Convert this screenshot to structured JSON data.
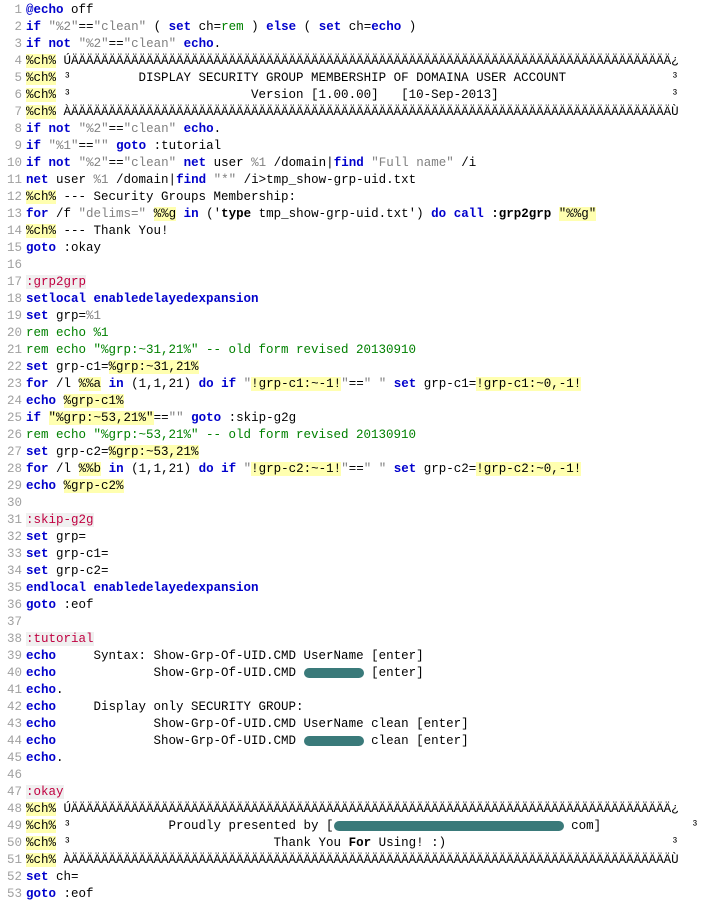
{
  "lines": [
    {
      "n": 1,
      "segs": [
        {
          "t": "@echo",
          "c": "kw"
        },
        {
          "t": " off"
        }
      ]
    },
    {
      "n": 2,
      "segs": [
        {
          "t": "if",
          "c": "kw"
        },
        {
          "t": " "
        },
        {
          "t": "\"%2\"",
          "c": "str"
        },
        {
          "t": "=="
        },
        {
          "t": "\"clean\"",
          "c": "str"
        },
        {
          "t": " ( "
        },
        {
          "t": "set",
          "c": "kw"
        },
        {
          "t": " ch="
        },
        {
          "t": "rem",
          "c": "cmt"
        },
        {
          "t": " ) "
        },
        {
          "t": "else",
          "c": "kw"
        },
        {
          "t": " ( "
        },
        {
          "t": "set",
          "c": "kw"
        },
        {
          "t": " ch="
        },
        {
          "t": "echo",
          "c": "kw"
        },
        {
          "t": " )"
        }
      ]
    },
    {
      "n": 3,
      "segs": [
        {
          "t": "if",
          "c": "kw"
        },
        {
          "t": " "
        },
        {
          "t": "not",
          "c": "kw"
        },
        {
          "t": " "
        },
        {
          "t": "\"%2\"",
          "c": "str"
        },
        {
          "t": "=="
        },
        {
          "t": "\"clean\"",
          "c": "str"
        },
        {
          "t": " "
        },
        {
          "t": "echo",
          "c": "kw"
        },
        {
          "t": "."
        }
      ]
    },
    {
      "n": 4,
      "segs": [
        {
          "t": "%ch%",
          "c": "hl"
        },
        {
          "t": " ÚÄÄÄÄÄÄÄÄÄÄÄÄÄÄÄÄÄÄÄÄÄÄÄÄÄÄÄÄÄÄÄÄÄÄÄÄÄÄÄÄÄÄÄÄÄÄÄÄÄÄÄÄÄÄÄÄÄÄÄÄÄÄÄÄÄÄÄÄÄÄÄÄÄÄÄÄÄÄÄÄ¿"
        }
      ]
    },
    {
      "n": 5,
      "segs": [
        {
          "t": "%ch%",
          "c": "hl"
        },
        {
          "t": " ³         DISPLAY SECURITY GROUP MEMBERSHIP OF DOMAINA USER ACCOUNT              ³"
        }
      ]
    },
    {
      "n": 6,
      "segs": [
        {
          "t": "%ch%",
          "c": "hl"
        },
        {
          "t": " ³                        Version [1.00.00]   [10-Sep-2013]                       ³"
        }
      ]
    },
    {
      "n": 7,
      "segs": [
        {
          "t": "%ch%",
          "c": "hl"
        },
        {
          "t": " ÀÄÄÄÄÄÄÄÄÄÄÄÄÄÄÄÄÄÄÄÄÄÄÄÄÄÄÄÄÄÄÄÄÄÄÄÄÄÄÄÄÄÄÄÄÄÄÄÄÄÄÄÄÄÄÄÄÄÄÄÄÄÄÄÄÄÄÄÄÄÄÄÄÄÄÄÄÄÄÄÄÙ"
        }
      ]
    },
    {
      "n": 8,
      "segs": [
        {
          "t": "if",
          "c": "kw"
        },
        {
          "t": " "
        },
        {
          "t": "not",
          "c": "kw"
        },
        {
          "t": " "
        },
        {
          "t": "\"%2\"",
          "c": "str"
        },
        {
          "t": "=="
        },
        {
          "t": "\"clean\"",
          "c": "str"
        },
        {
          "t": " "
        },
        {
          "t": "echo",
          "c": "kw"
        },
        {
          "t": "."
        }
      ]
    },
    {
      "n": 9,
      "segs": [
        {
          "t": "if",
          "c": "kw"
        },
        {
          "t": " "
        },
        {
          "t": "\"%1\"",
          "c": "str"
        },
        {
          "t": "=="
        },
        {
          "t": "\"\"",
          "c": "str"
        },
        {
          "t": " "
        },
        {
          "t": "goto",
          "c": "kw"
        },
        {
          "t": " :tutorial",
          "c": "lblref"
        }
      ]
    },
    {
      "n": 10,
      "segs": [
        {
          "t": "if",
          "c": "kw"
        },
        {
          "t": " "
        },
        {
          "t": "not",
          "c": "kw"
        },
        {
          "t": " "
        },
        {
          "t": "\"%2\"",
          "c": "str"
        },
        {
          "t": "=="
        },
        {
          "t": "\"clean\"",
          "c": "str"
        },
        {
          "t": " "
        },
        {
          "t": "net",
          "c": "kw"
        },
        {
          "t": " user "
        },
        {
          "t": "%1",
          "c": "var"
        },
        {
          "t": " /domain|"
        },
        {
          "t": "find",
          "c": "kw"
        },
        {
          "t": " "
        },
        {
          "t": "\"Full name\"",
          "c": "str"
        },
        {
          "t": " /i"
        }
      ]
    },
    {
      "n": 11,
      "segs": [
        {
          "t": "net",
          "c": "kw"
        },
        {
          "t": " user "
        },
        {
          "t": "%1",
          "c": "var"
        },
        {
          "t": " /domain|"
        },
        {
          "t": "find",
          "c": "kw"
        },
        {
          "t": " "
        },
        {
          "t": "\"*\"",
          "c": "str"
        },
        {
          "t": " /i>tmp_show-grp-uid.txt"
        }
      ]
    },
    {
      "n": 12,
      "segs": [
        {
          "t": "%ch%",
          "c": "hl"
        },
        {
          "t": " --- Security Groups Membership:"
        }
      ]
    },
    {
      "n": 13,
      "segs": [
        {
          "t": "for",
          "c": "kw"
        },
        {
          "t": " /f "
        },
        {
          "t": "\"delims=\"",
          "c": "str"
        },
        {
          "t": " "
        },
        {
          "t": "%%g",
          "c": "hl"
        },
        {
          "t": " "
        },
        {
          "t": "in",
          "c": "kw"
        },
        {
          "t": " ('"
        },
        {
          "t": "type",
          "c": "bkw"
        },
        {
          "t": " tmp_show-grp-uid.txt') "
        },
        {
          "t": "do",
          "c": "kw"
        },
        {
          "t": " "
        },
        {
          "t": "call",
          "c": "kw"
        },
        {
          "t": " "
        },
        {
          "t": ":grp2grp",
          "c": "bkw"
        },
        {
          "t": " "
        },
        {
          "t": "\"%%g\"",
          "c": "hl"
        }
      ]
    },
    {
      "n": 14,
      "segs": [
        {
          "t": "%ch%",
          "c": "hl"
        },
        {
          "t": " --- Thank You!"
        }
      ]
    },
    {
      "n": 15,
      "segs": [
        {
          "t": "goto",
          "c": "kw"
        },
        {
          "t": " :okay",
          "c": "lblref"
        }
      ]
    },
    {
      "n": 16,
      "segs": [
        {
          "t": ""
        }
      ]
    },
    {
      "n": 17,
      "segs": [
        {
          "t": ":grp2grp",
          "c": "lbl"
        }
      ]
    },
    {
      "n": 18,
      "segs": [
        {
          "t": "setlocal",
          "c": "kw"
        },
        {
          "t": " "
        },
        {
          "t": "enabledelayedexpansion",
          "c": "kw"
        }
      ]
    },
    {
      "n": 19,
      "segs": [
        {
          "t": "set",
          "c": "kw"
        },
        {
          "t": " grp="
        },
        {
          "t": "%1",
          "c": "var"
        }
      ]
    },
    {
      "n": 20,
      "segs": [
        {
          "t": "rem echo %1",
          "c": "cmt"
        }
      ]
    },
    {
      "n": 21,
      "segs": [
        {
          "t": "rem echo \"%grp:~31,21%\" -- old form revised 20130910",
          "c": "cmt"
        }
      ]
    },
    {
      "n": 22,
      "segs": [
        {
          "t": "set",
          "c": "kw"
        },
        {
          "t": " grp-c1="
        },
        {
          "t": "%grp:~31,21%",
          "c": "hl"
        }
      ]
    },
    {
      "n": 23,
      "segs": [
        {
          "t": "for",
          "c": "kw"
        },
        {
          "t": " /l "
        },
        {
          "t": "%%a",
          "c": "hl"
        },
        {
          "t": " "
        },
        {
          "t": "in",
          "c": "kw"
        },
        {
          "t": " (1,1,21) "
        },
        {
          "t": "do",
          "c": "kw"
        },
        {
          "t": " "
        },
        {
          "t": "if",
          "c": "kw"
        },
        {
          "t": " "
        },
        {
          "t": "\"",
          "c": "str"
        },
        {
          "t": "!grp-c1:~-1!",
          "c": "hl"
        },
        {
          "t": "\"",
          "c": "str"
        },
        {
          "t": "=="
        },
        {
          "t": "\" \"",
          "c": "str"
        },
        {
          "t": " "
        },
        {
          "t": "set",
          "c": "kw"
        },
        {
          "t": " grp-c1="
        },
        {
          "t": "!grp-c1:~0,-1!",
          "c": "hl"
        }
      ]
    },
    {
      "n": 24,
      "segs": [
        {
          "t": "echo",
          "c": "kw"
        },
        {
          "t": " "
        },
        {
          "t": "%grp-c1%",
          "c": "hl"
        }
      ]
    },
    {
      "n": 25,
      "segs": [
        {
          "t": "if",
          "c": "kw"
        },
        {
          "t": " "
        },
        {
          "t": "\"%grp:~53,21%\"",
          "c": "hl"
        },
        {
          "t": "=="
        },
        {
          "t": "\"\"",
          "c": "str"
        },
        {
          "t": " "
        },
        {
          "t": "goto",
          "c": "kw"
        },
        {
          "t": " :skip-g2g",
          "c": "lblref"
        }
      ]
    },
    {
      "n": 26,
      "segs": [
        {
          "t": "rem echo \"%grp:~53,21%\" -- old form revised 20130910",
          "c": "cmt"
        }
      ]
    },
    {
      "n": 27,
      "segs": [
        {
          "t": "set",
          "c": "kw"
        },
        {
          "t": " grp-c2="
        },
        {
          "t": "%grp:~53,21%",
          "c": "hl"
        }
      ]
    },
    {
      "n": 28,
      "segs": [
        {
          "t": "for",
          "c": "kw"
        },
        {
          "t": " /l "
        },
        {
          "t": "%%b",
          "c": "hl"
        },
        {
          "t": " "
        },
        {
          "t": "in",
          "c": "kw"
        },
        {
          "t": " (1,1,21) "
        },
        {
          "t": "do",
          "c": "kw"
        },
        {
          "t": " "
        },
        {
          "t": "if",
          "c": "kw"
        },
        {
          "t": " "
        },
        {
          "t": "\"",
          "c": "str"
        },
        {
          "t": "!grp-c2:~-1!",
          "c": "hl"
        },
        {
          "t": "\"",
          "c": "str"
        },
        {
          "t": "=="
        },
        {
          "t": "\" \"",
          "c": "str"
        },
        {
          "t": " "
        },
        {
          "t": "set",
          "c": "kw"
        },
        {
          "t": " grp-c2="
        },
        {
          "t": "!grp-c2:~0,-1!",
          "c": "hl"
        }
      ]
    },
    {
      "n": 29,
      "segs": [
        {
          "t": "echo",
          "c": "kw"
        },
        {
          "t": " "
        },
        {
          "t": "%grp-c2%",
          "c": "hl"
        }
      ]
    },
    {
      "n": 30,
      "segs": [
        {
          "t": ""
        }
      ]
    },
    {
      "n": 31,
      "segs": [
        {
          "t": ":skip-g2g",
          "c": "lbl"
        }
      ]
    },
    {
      "n": 32,
      "segs": [
        {
          "t": "set",
          "c": "kw"
        },
        {
          "t": " grp="
        }
      ]
    },
    {
      "n": 33,
      "segs": [
        {
          "t": "set",
          "c": "kw"
        },
        {
          "t": " grp-c1="
        }
      ]
    },
    {
      "n": 34,
      "segs": [
        {
          "t": "set",
          "c": "kw"
        },
        {
          "t": " grp-c2="
        }
      ]
    },
    {
      "n": 35,
      "segs": [
        {
          "t": "endlocal",
          "c": "kw"
        },
        {
          "t": " "
        },
        {
          "t": "enabledelayedexpansion",
          "c": "kw"
        }
      ]
    },
    {
      "n": 36,
      "segs": [
        {
          "t": "goto",
          "c": "kw"
        },
        {
          "t": " :eof",
          "c": "lblref"
        }
      ]
    },
    {
      "n": 37,
      "segs": [
        {
          "t": ""
        }
      ]
    },
    {
      "n": 38,
      "segs": [
        {
          "t": ":tutorial",
          "c": "lbl"
        }
      ]
    },
    {
      "n": 39,
      "segs": [
        {
          "t": "echo",
          "c": "kw"
        },
        {
          "t": "     Syntax: Show-Grp-Of-UID.CMD UserName [enter]"
        }
      ]
    },
    {
      "n": 40,
      "segs": [
        {
          "t": "echo",
          "c": "kw"
        },
        {
          "t": "             Show-Grp-Of-UID.CMD "
        },
        {
          "r": 60
        },
        {
          "t": " [enter]"
        }
      ]
    },
    {
      "n": 41,
      "segs": [
        {
          "t": "echo",
          "c": "kw"
        },
        {
          "t": "."
        }
      ]
    },
    {
      "n": 42,
      "segs": [
        {
          "t": "echo",
          "c": "kw"
        },
        {
          "t": "     Display only SECURITY GROUP:"
        }
      ]
    },
    {
      "n": 43,
      "segs": [
        {
          "t": "echo",
          "c": "kw"
        },
        {
          "t": "             Show-Grp-Of-UID.CMD UserName clean [enter]"
        }
      ]
    },
    {
      "n": 44,
      "segs": [
        {
          "t": "echo",
          "c": "kw"
        },
        {
          "t": "             Show-Grp-Of-UID.CMD "
        },
        {
          "r": 60
        },
        {
          "t": " clean [enter]"
        }
      ]
    },
    {
      "n": 45,
      "segs": [
        {
          "t": "echo",
          "c": "kw"
        },
        {
          "t": "."
        }
      ]
    },
    {
      "n": 46,
      "segs": [
        {
          "t": ""
        }
      ]
    },
    {
      "n": 47,
      "segs": [
        {
          "t": ":okay",
          "c": "lbl"
        }
      ]
    },
    {
      "n": 48,
      "segs": [
        {
          "t": "%ch%",
          "c": "hl"
        },
        {
          "t": " ÚÄÄÄÄÄÄÄÄÄÄÄÄÄÄÄÄÄÄÄÄÄÄÄÄÄÄÄÄÄÄÄÄÄÄÄÄÄÄÄÄÄÄÄÄÄÄÄÄÄÄÄÄÄÄÄÄÄÄÄÄÄÄÄÄÄÄÄÄÄÄÄÄÄÄÄÄÄÄÄÄ¿"
        }
      ]
    },
    {
      "n": 49,
      "segs": [
        {
          "t": "%ch%",
          "c": "hl"
        },
        {
          "t": " ³             Proudly presented by ["
        },
        {
          "r": 230
        },
        {
          "t": " com]            ³"
        }
      ]
    },
    {
      "n": 50,
      "segs": [
        {
          "t": "%ch%",
          "c": "hl"
        },
        {
          "t": " ³                           Thank You "
        },
        {
          "t": "For",
          "c": "bkw"
        },
        {
          "t": " Using! :)                              ³"
        }
      ]
    },
    {
      "n": 51,
      "segs": [
        {
          "t": "%ch%",
          "c": "hl"
        },
        {
          "t": " ÀÄÄÄÄÄÄÄÄÄÄÄÄÄÄÄÄÄÄÄÄÄÄÄÄÄÄÄÄÄÄÄÄÄÄÄÄÄÄÄÄÄÄÄÄÄÄÄÄÄÄÄÄÄÄÄÄÄÄÄÄÄÄÄÄÄÄÄÄÄÄÄÄÄÄÄÄÄÄÄÄÙ"
        }
      ]
    },
    {
      "n": 52,
      "segs": [
        {
          "t": "set",
          "c": "kw"
        },
        {
          "t": " ch="
        }
      ]
    },
    {
      "n": 53,
      "segs": [
        {
          "t": "goto",
          "c": "kw"
        },
        {
          "t": " :eof",
          "c": "lblref"
        }
      ]
    }
  ]
}
